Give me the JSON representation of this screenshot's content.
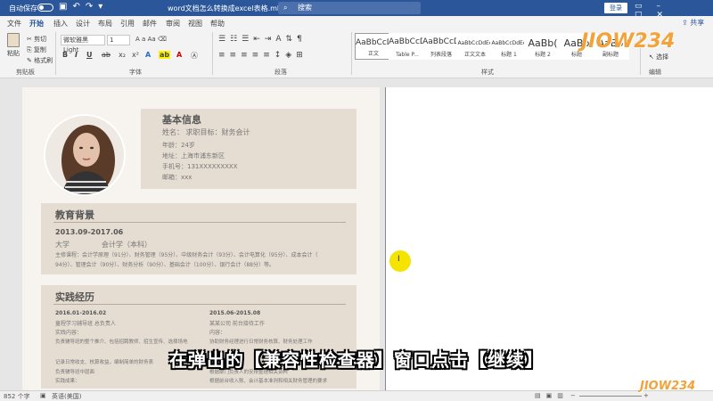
{
  "titlebar": {
    "autosave": "自动保存",
    "doc_title": "word文档怎么转换成excel表格.mht - 兼...",
    "search": "搜索",
    "login": "登录"
  },
  "menu": {
    "tabs": [
      "文件",
      "开始",
      "插入",
      "设计",
      "布局",
      "引用",
      "邮件",
      "审阅",
      "视图",
      "帮助"
    ],
    "active": "开始",
    "share": "共享"
  },
  "ribbon": {
    "paste": "粘贴",
    "cut": "剪切",
    "copy": "复制",
    "format_painter": "格式刷",
    "clipboard": "剪贴板",
    "font_name": "微软雅黑 Light",
    "font_size": "1",
    "font_group": "字体",
    "paragraph_group": "段落",
    "styles_group": "样式",
    "editing_group": "编辑",
    "select": "选择",
    "styles": [
      {
        "sample": "AaBbCcD",
        "name": "正文"
      },
      {
        "sample": "AaBbCcD",
        "name": "Table P..."
      },
      {
        "sample": "AaBbCcD",
        "name": "列表段落"
      },
      {
        "sample": "AaBbCcDdEe",
        "name": "正文文本"
      },
      {
        "sample": "AaBbCcDdEe",
        "name": "标题 1"
      },
      {
        "sample": "AaBb(",
        "name": "标题 2"
      },
      {
        "sample": "AaBb",
        "name": "标题"
      },
      {
        "sample": "AaBb",
        "name": "副标题"
      }
    ]
  },
  "resume": {
    "basic_title": "基本信息",
    "name_line": "姓名：   求职目标：财务会计",
    "age": "年龄：24岁",
    "address": "地址：上海市浦东新区",
    "phone": "手机号：131XXXXXXXXX",
    "email": "邮箱：xxx",
    "edu_title": "教育背景",
    "edu_dates": "2013.09-2017.06",
    "edu_school": "大学",
    "edu_major": "会计学（本科）",
    "edu_courses_1": "主修课程：会计学原理（91分）、财务管理（95分）、中级财务会计（93分）、会计电算化（95分）、成本会计（",
    "edu_courses_2": "94分）、管理会计（90分）、财务分析（90分）、基础会计（100分）、银行会计（88分）等。",
    "exp_title": "实践经历",
    "exp1_date": "2016.01-2016.02",
    "exp1_role": "童程学习辅导班 总负责人",
    "exp1_label": "实践内容：",
    "exp1_items": [
      "负责辅导班的整个推介、包括招聘教师、招生宣传、选择场地",
      "记录日常收支、核算收益，编制简单的财务表",
      "负责辅导班中层面"
    ],
    "exp1_more": "实践成果：",
    "exp2_date": "2015.06-2015.08",
    "exp2_role": "某某公司 前台接待工作",
    "exp2_label": "内容：",
    "exp2_items": [
      "协助财务经理进行日常财务核算、财务处理工作",
      "成本预测",
      "根据部门负责人的安排整理相关资料",
      "根据前台收入账、会计基本准则和相关财务管理的要求"
    ]
  },
  "subtitle": "在弹出的【兼容性检查器】窗口点击【继续】",
  "statusbar": {
    "words": "852 个字",
    "language": "英语(美国)",
    "zoom": "80%"
  },
  "watermark": "JIOW234"
}
